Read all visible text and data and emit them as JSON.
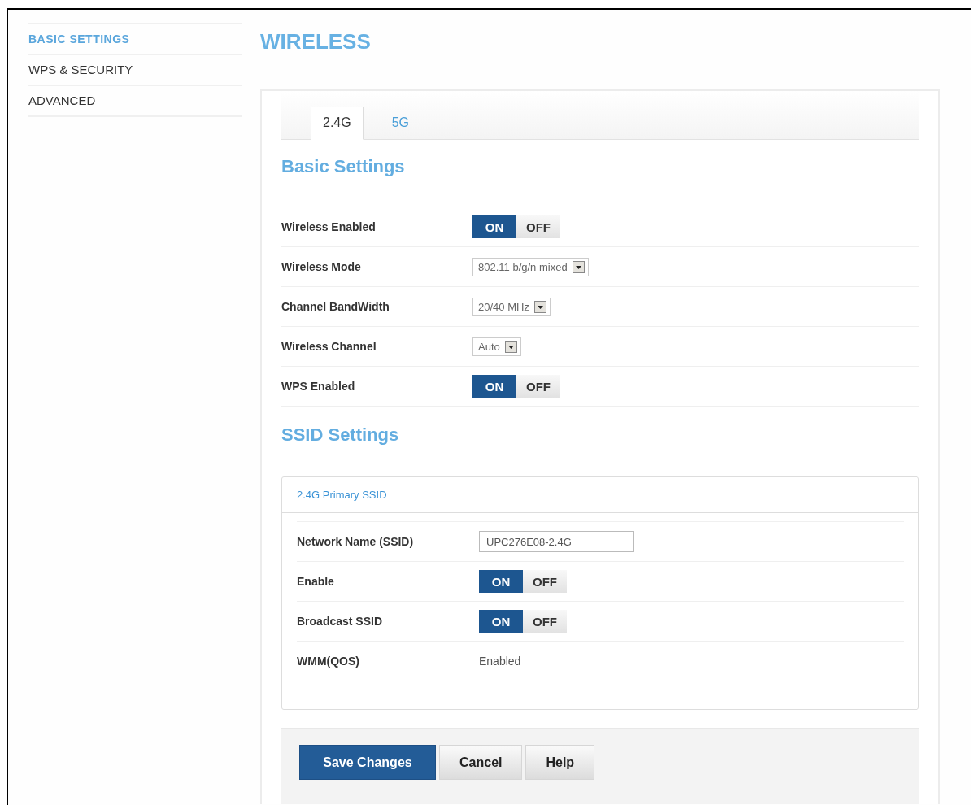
{
  "sidebar": {
    "items": [
      {
        "label": "BASIC SETTINGS",
        "selected": true
      },
      {
        "label": "WPS & SECURITY",
        "selected": false
      },
      {
        "label": "ADVANCED",
        "selected": false
      }
    ]
  },
  "page_title": "WIRELESS",
  "tabs": [
    {
      "label": "2.4G",
      "selected": true
    },
    {
      "label": "5G",
      "selected": false
    }
  ],
  "basic_settings": {
    "title": "Basic Settings",
    "rows": [
      {
        "kind": "toggle",
        "label": "Wireless Enabled",
        "on": true,
        "on_label": "ON",
        "off_label": "OFF"
      },
      {
        "kind": "select",
        "label": "Wireless Mode",
        "value": "802.11 b/g/n mixed"
      },
      {
        "kind": "select",
        "label": "Channel BandWidth",
        "value": "20/40 MHz"
      },
      {
        "kind": "select",
        "label": "Wireless Channel",
        "value": "Auto"
      },
      {
        "kind": "toggle",
        "label": "WPS Enabled",
        "on": true,
        "on_label": "ON",
        "off_label": "OFF"
      }
    ]
  },
  "ssid_settings": {
    "title": "SSID Settings",
    "panel_title": "2.4G Primary SSID",
    "rows": [
      {
        "kind": "input",
        "label": "Network Name (SSID)",
        "value": "UPC276E08-2.4G"
      },
      {
        "kind": "toggle",
        "label": "Enable",
        "on": true,
        "on_label": "ON",
        "off_label": "OFF"
      },
      {
        "kind": "toggle",
        "label": "Broadcast SSID",
        "on": true,
        "on_label": "ON",
        "off_label": "OFF"
      },
      {
        "kind": "text",
        "label": "WMM(QOS)",
        "value": "Enabled"
      }
    ]
  },
  "buttons": [
    {
      "label": "Save Changes",
      "kind": "primary"
    },
    {
      "label": "Cancel",
      "kind": "secondary"
    },
    {
      "label": "Help",
      "kind": "secondary"
    }
  ]
}
